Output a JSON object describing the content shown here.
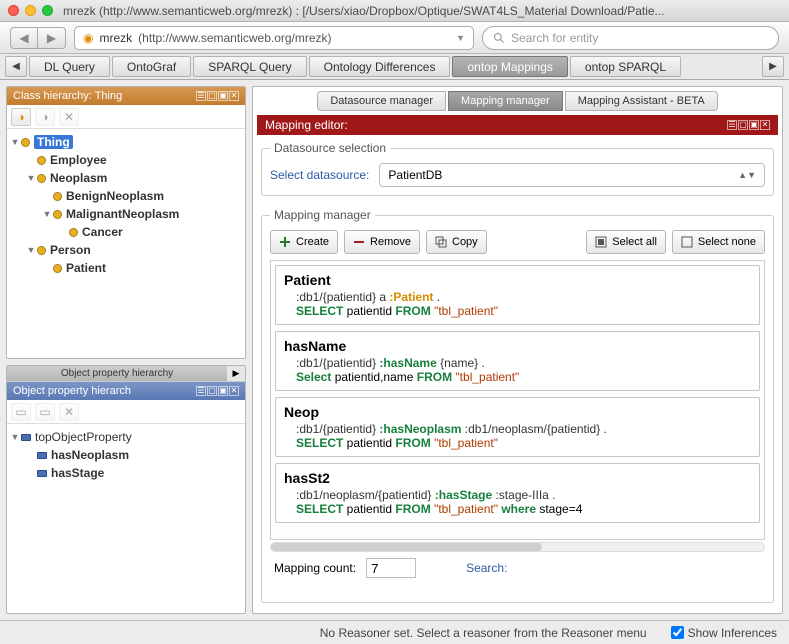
{
  "window": {
    "title": "mrezk (http://www.semanticweb.org/mrezk)  : [/Users/xiao/Dropbox/Optique/SWAT4LS_Material Download/Patie..."
  },
  "urlbar": {
    "host": "mrezk",
    "url": "(http://www.semanticweb.org/mrezk)"
  },
  "search": {
    "placeholder": "Search for entity"
  },
  "tabs": {
    "items": [
      {
        "label": "DL Query"
      },
      {
        "label": "OntoGraf"
      },
      {
        "label": "SPARQL Query"
      },
      {
        "label": "Ontology Differences"
      },
      {
        "label": "ontop Mappings",
        "active": true
      },
      {
        "label": "ontop SPARQL"
      }
    ]
  },
  "class_hierarchy": {
    "title": "Class hierarchy: Thing",
    "tree": {
      "root": "Thing",
      "n1": "Employee",
      "n2": "Neoplasm",
      "n3": "BenignNeoplasm",
      "n4": "MalignantNeoplasm",
      "n5": "Cancer",
      "n6": "Person",
      "n7": "Patient"
    }
  },
  "obj_prop": {
    "tab_label": "Object property hierarchy",
    "header": "Object property hierarch",
    "root": "topObjectProperty",
    "p1": "hasNeoplasm",
    "p2": "hasStage"
  },
  "subtabs": {
    "t1": "Datasource manager",
    "t2": "Mapping manager",
    "t3": "Mapping Assistant - BETA"
  },
  "mapping_editor": {
    "title": "Mapping editor:"
  },
  "datasource": {
    "legend": "Datasource selection",
    "label": "Select datasource:",
    "value": "PatientDB"
  },
  "mapping_manager": {
    "legend": "Mapping manager",
    "btn_create": "Create",
    "btn_remove": "Remove",
    "btn_copy": "Copy",
    "btn_select_all": "Select all",
    "btn_select_none": "Select none",
    "mappings": [
      {
        "title": "Patient",
        "triple_pre": ":db1/{patientid} a ",
        "triple_pred_or_type": ":Patient",
        "triple_post": " .",
        "is_type": true,
        "sql": [
          {
            "t": "kw",
            "v": "SELECT"
          },
          {
            "t": "",
            "v": " patientid "
          },
          {
            "t": "kw",
            "v": "FROM"
          },
          {
            "t": "",
            "v": " "
          },
          {
            "t": "tbl",
            "v": "\"tbl_patient\""
          }
        ]
      },
      {
        "title": "hasName",
        "triple_pre": ":db1/{patientid} ",
        "triple_pred_or_type": ":hasName",
        "triple_post": " {name} .",
        "is_type": false,
        "sql": [
          {
            "t": "kw",
            "v": "Select"
          },
          {
            "t": "",
            "v": " patientid,name "
          },
          {
            "t": "kw",
            "v": "FROM"
          },
          {
            "t": "",
            "v": " "
          },
          {
            "t": "tbl",
            "v": "\"tbl_patient\""
          }
        ]
      },
      {
        "title": "Neop",
        "triple_pre": ":db1/{patientid} ",
        "triple_pred_or_type": ":hasNeoplasm",
        "triple_post": " :db1/neoplasm/{patientid} .",
        "is_type": false,
        "sql": [
          {
            "t": "kw",
            "v": "SELECT"
          },
          {
            "t": "",
            "v": " patientid "
          },
          {
            "t": "kw",
            "v": "FROM"
          },
          {
            "t": "",
            "v": " "
          },
          {
            "t": "tbl",
            "v": "\"tbl_patient\""
          }
        ]
      },
      {
        "title": "hasSt2",
        "triple_pre": ":db1/neoplasm/{patientid} ",
        "triple_pred_or_type": ":hasStage",
        "triple_post": " :stage-IIIa .",
        "is_type": false,
        "sql": [
          {
            "t": "kw",
            "v": "SELECT"
          },
          {
            "t": "",
            "v": " patientid "
          },
          {
            "t": "kw",
            "v": "FROM"
          },
          {
            "t": "",
            "v": " "
          },
          {
            "t": "tbl",
            "v": "\"tbl_patient\""
          },
          {
            "t": "",
            "v": " "
          },
          {
            "t": "kw",
            "v": "where"
          },
          {
            "t": "",
            "v": " stage=4"
          }
        ]
      }
    ],
    "count_label": "Mapping count:",
    "count_value": "7",
    "search_label": "Search:"
  },
  "status": {
    "message": "No Reasoner set. Select a reasoner from the Reasoner menu",
    "show_inferences": "Show Inferences"
  }
}
